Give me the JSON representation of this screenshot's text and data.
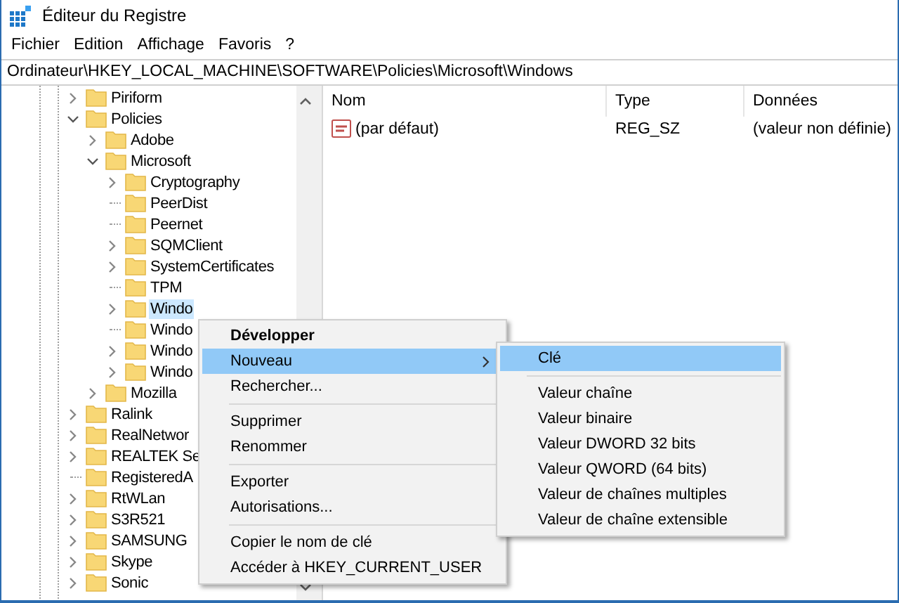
{
  "window": {
    "title": "Éditeur du Registre"
  },
  "menu_bar": [
    "Fichier",
    "Edition",
    "Affichage",
    "Favoris",
    "?"
  ],
  "address_bar": {
    "value": "Ordinateur\\HKEY_LOCAL_MACHINE\\SOFTWARE\\Policies\\Microsoft\\Windows"
  },
  "tree": {
    "items": [
      {
        "label": "Piriform",
        "expandable": true,
        "expanded": false,
        "selected": false
      },
      {
        "label": "Policies",
        "expandable": true,
        "expanded": true,
        "selected": false,
        "children": [
          {
            "label": "Adobe",
            "expandable": true,
            "expanded": false,
            "selected": false
          },
          {
            "label": "Microsoft",
            "expandable": true,
            "expanded": true,
            "selected": false,
            "children": [
              {
                "label": "Cryptography",
                "expandable": true,
                "expanded": false,
                "selected": false
              },
              {
                "label": "PeerDist",
                "expandable": false,
                "expanded": false,
                "selected": false
              },
              {
                "label": "Peernet",
                "expandable": false,
                "expanded": false,
                "selected": false
              },
              {
                "label": "SQMClient",
                "expandable": true,
                "expanded": false,
                "selected": false
              },
              {
                "label": "SystemCertificates",
                "expandable": true,
                "expanded": false,
                "selected": false
              },
              {
                "label": "TPM",
                "expandable": false,
                "expanded": false,
                "selected": false
              },
              {
                "label": "Windo",
                "expandable": true,
                "expanded": false,
                "selected": true
              },
              {
                "label": "Windo",
                "expandable": false,
                "expanded": false,
                "selected": false
              },
              {
                "label": "Windo",
                "expandable": true,
                "expanded": false,
                "selected": false
              },
              {
                "label": "Windo",
                "expandable": true,
                "expanded": false,
                "selected": false
              }
            ]
          },
          {
            "label": "Mozilla",
            "expandable": true,
            "expanded": false,
            "selected": false
          }
        ]
      },
      {
        "label": "Ralink",
        "expandable": true,
        "expanded": false,
        "selected": false
      },
      {
        "label": "RealNetwor",
        "expandable": true,
        "expanded": false,
        "selected": false
      },
      {
        "label": "REALTEK Se",
        "expandable": true,
        "expanded": false,
        "selected": false
      },
      {
        "label": "RegisteredA",
        "expandable": false,
        "expanded": false,
        "selected": false
      },
      {
        "label": "RtWLan",
        "expandable": true,
        "expanded": false,
        "selected": false
      },
      {
        "label": "S3R521",
        "expandable": true,
        "expanded": false,
        "selected": false
      },
      {
        "label": "SAMSUNG",
        "expandable": true,
        "expanded": false,
        "selected": false
      },
      {
        "label": "Skype",
        "expandable": true,
        "expanded": false,
        "selected": false
      },
      {
        "label": "Sonic",
        "expandable": true,
        "expanded": false,
        "selected": false
      }
    ]
  },
  "list": {
    "columns": [
      "Nom",
      "Type",
      "Données"
    ],
    "rows": [
      {
        "name": "(par défaut)",
        "type": "REG_SZ",
        "data": "(valeur non définie)"
      }
    ]
  },
  "context_menu": {
    "items": [
      {
        "kind": "item",
        "label": "Développer",
        "bold": true,
        "selected": false,
        "submenu": false
      },
      {
        "kind": "item",
        "label": "Nouveau",
        "bold": false,
        "selected": true,
        "submenu": true
      },
      {
        "kind": "item",
        "label": "Rechercher...",
        "bold": false,
        "selected": false,
        "submenu": false
      },
      {
        "kind": "separator"
      },
      {
        "kind": "item",
        "label": "Supprimer",
        "bold": false,
        "selected": false,
        "submenu": false
      },
      {
        "kind": "item",
        "label": "Renommer",
        "bold": false,
        "selected": false,
        "submenu": false
      },
      {
        "kind": "separator"
      },
      {
        "kind": "item",
        "label": "Exporter",
        "bold": false,
        "selected": false,
        "submenu": false
      },
      {
        "kind": "item",
        "label": "Autorisations...",
        "bold": false,
        "selected": false,
        "submenu": false
      },
      {
        "kind": "separator"
      },
      {
        "kind": "item",
        "label": "Copier le nom de clé",
        "bold": false,
        "selected": false,
        "submenu": false
      },
      {
        "kind": "item",
        "label": "Accéder à HKEY_CURRENT_USER",
        "bold": false,
        "selected": false,
        "submenu": false
      }
    ]
  },
  "submenu": {
    "items": [
      {
        "kind": "item",
        "label": "Clé",
        "selected": true
      },
      {
        "kind": "separator"
      },
      {
        "kind": "item",
        "label": "Valeur chaîne",
        "selected": false
      },
      {
        "kind": "item",
        "label": "Valeur binaire",
        "selected": false
      },
      {
        "kind": "item",
        "label": "Valeur DWORD 32 bits",
        "selected": false
      },
      {
        "kind": "item",
        "label": "Valeur QWORD (64 bits)",
        "selected": false
      },
      {
        "kind": "item",
        "label": "Valeur de chaînes multiples",
        "selected": false
      },
      {
        "kind": "item",
        "label": "Valeur de chaîne extensible",
        "selected": false
      }
    ]
  }
}
